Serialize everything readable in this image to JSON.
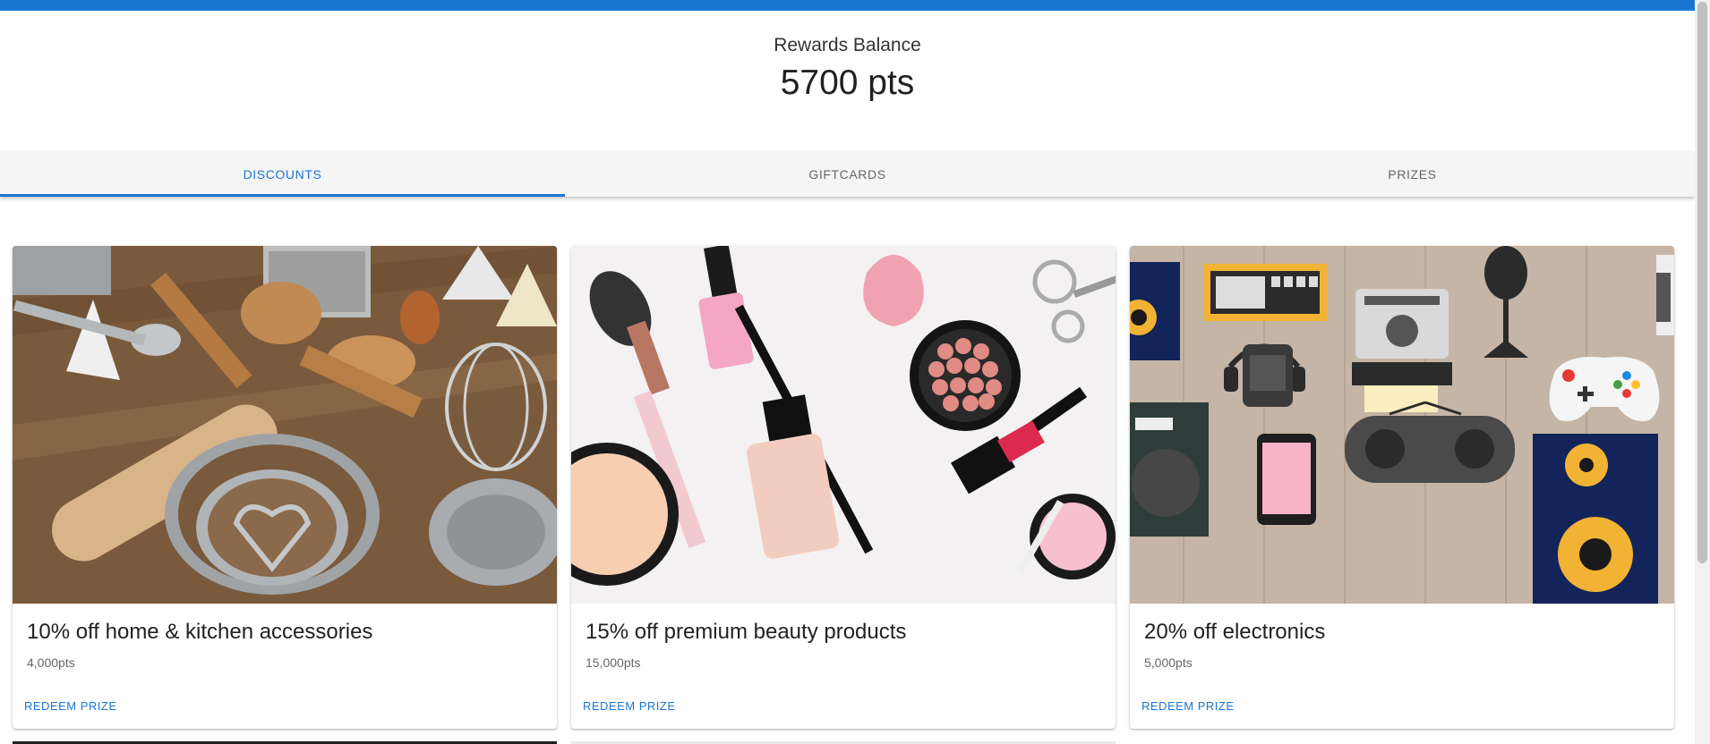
{
  "header": {
    "balance_label": "Rewards Balance",
    "balance_value": "5700 pts"
  },
  "tabs": [
    {
      "label": "DISCOUNTS",
      "active": true
    },
    {
      "label": "GIFTCARDS",
      "active": false
    },
    {
      "label": "PRIZES",
      "active": false
    }
  ],
  "cards": [
    {
      "title": "10% off home & kitchen accessories",
      "points": "4,000pts",
      "action": "REDEEM PRIZE",
      "image": "kitchen-utensils-image"
    },
    {
      "title": "15% off premium beauty products",
      "points": "15,000pts",
      "action": "REDEEM PRIZE",
      "image": "makeup-products-image"
    },
    {
      "title": "20% off electronics",
      "points": "5,000pts",
      "action": "REDEEM PRIZE",
      "image": "electronics-illustration-image"
    }
  ],
  "colors": {
    "accent": "#1976d2",
    "tab_bar": "#f5f5f5"
  }
}
